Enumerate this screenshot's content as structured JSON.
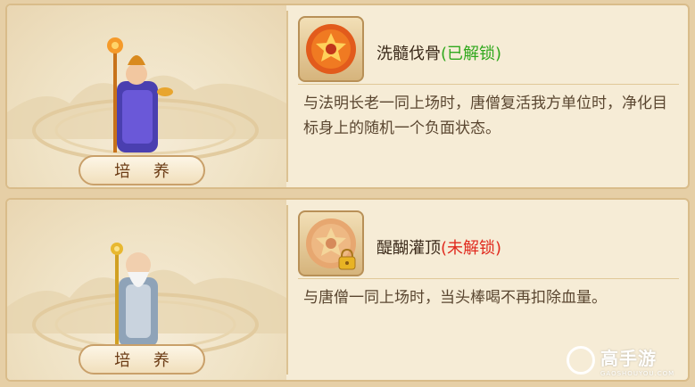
{
  "colors": {
    "unlocked": "#2fa81c",
    "locked": "#e02a1e",
    "panel_bg": "#f6ecd6",
    "border": "#d9bc8a"
  },
  "cards": [
    {
      "character_icon": "monk-figure-icon",
      "train_label": "培 养",
      "skill_icon": "golden-orb-icon",
      "skill_name": "洗髓伐骨",
      "status_open": "(",
      "status": "已解锁",
      "status_close": ")",
      "description": "与法明长老一同上场时，唐僧复活我方单位时，净化目标身上的随机一个负面状态。"
    },
    {
      "character_icon": "elder-figure-icon",
      "train_label": "培 养",
      "skill_icon": "golden-orb-locked-icon",
      "skill_name": "醍醐灌顶",
      "status_open": "(",
      "status": "未解锁",
      "status_close": ")",
      "description": "与唐僧一同上场时，当头棒喝不再扣除血量。"
    }
  ],
  "watermark": {
    "name": "高手游",
    "domain": "GAOSHOUYOU.COM"
  }
}
